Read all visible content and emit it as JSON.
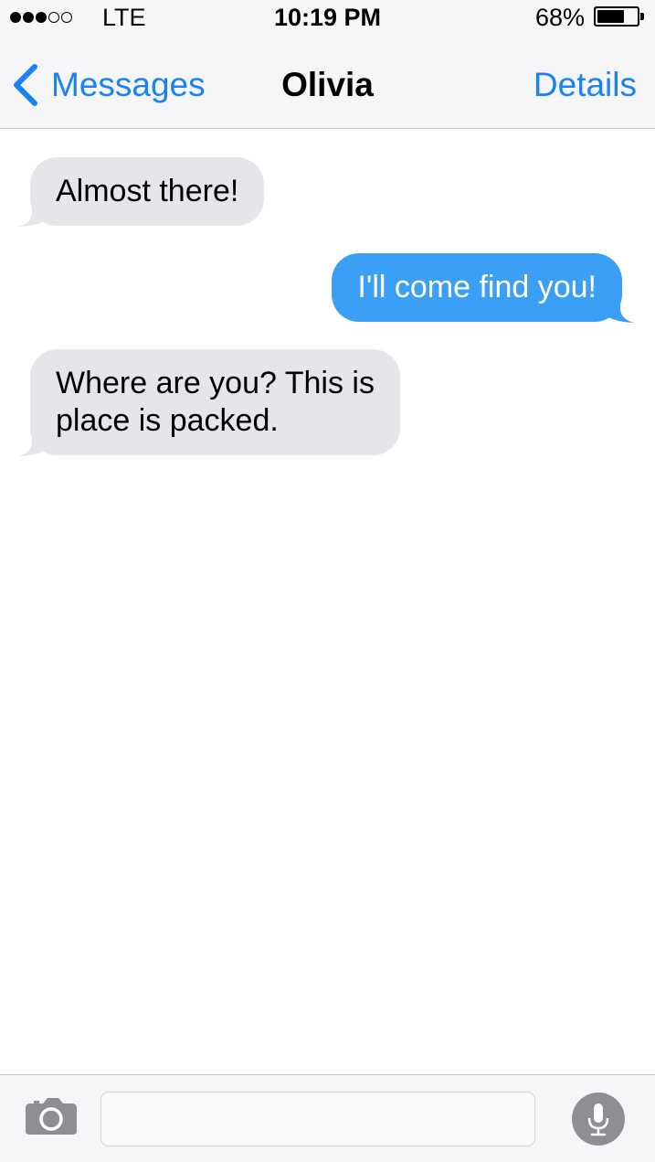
{
  "status_bar": {
    "signal_bars_filled": 3,
    "signal_bars_total": 5,
    "carrier": "LTE",
    "time": "10:19 PM",
    "battery_percent_label": "68%",
    "battery_level": 0.68
  },
  "nav": {
    "back_label": "Messages",
    "title": "Olivia",
    "details_label": "Details"
  },
  "messages": [
    {
      "direction": "received",
      "text": "Almost there!"
    },
    {
      "direction": "sent",
      "text": "I'll come find you!"
    },
    {
      "direction": "received",
      "lines": [
        "Where are you? This is",
        "place is packed."
      ]
    }
  ],
  "composer": {
    "input_value": "",
    "camera_icon": "camera-icon",
    "mic_icon": "microphone-icon"
  },
  "colors": {
    "accent": "#1a82f7",
    "sent_bubble": "#3b9ff5",
    "received_bubble": "#e5e5ea",
    "bar_background": "#f6f6f8"
  }
}
